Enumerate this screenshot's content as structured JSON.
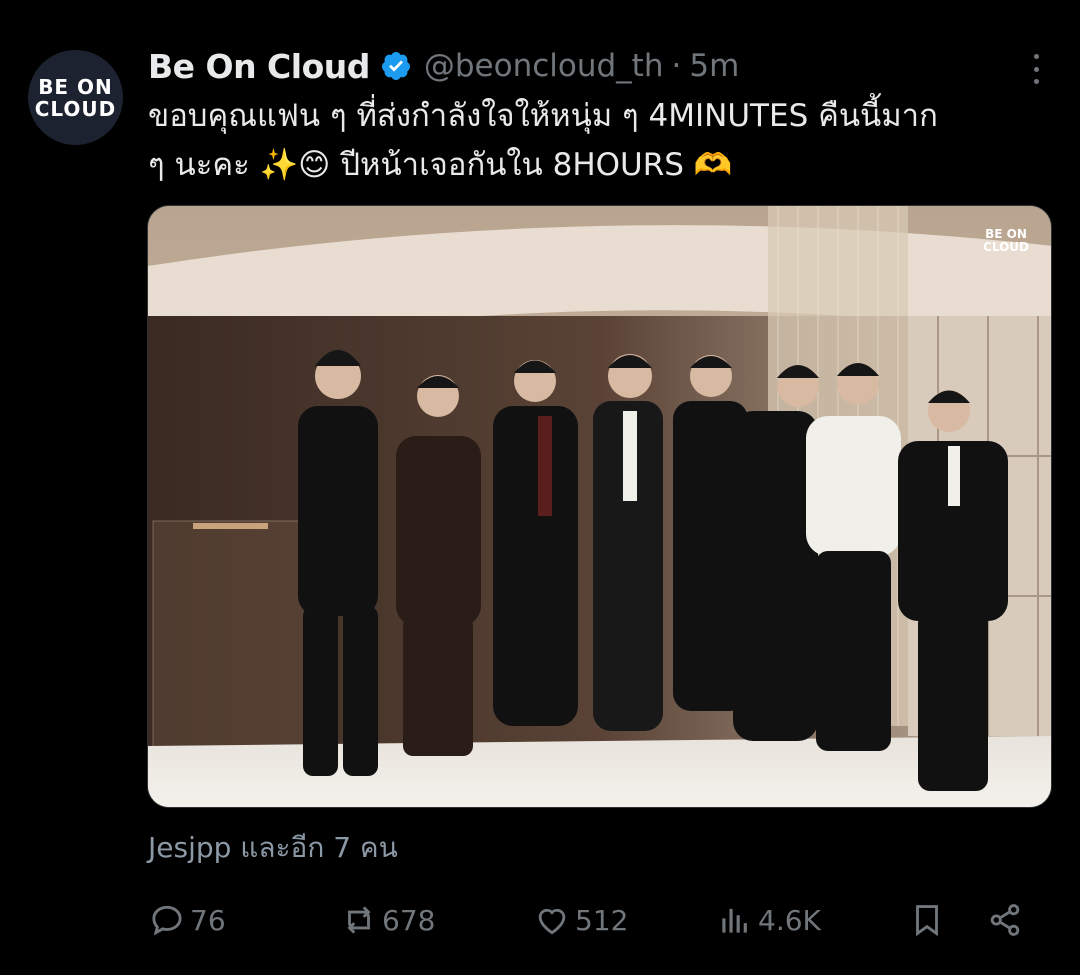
{
  "account": {
    "avatar_text_line1": "BE ON",
    "avatar_text_line2": "CLOUD",
    "display_name": "Be On Cloud",
    "handle": "@beoncloud_th",
    "separator": "·",
    "time": "5m",
    "verified": true
  },
  "tweet": {
    "line1": "ขอบคุณแฟน ๆ ที่ส่งกำลังใจให้หนุ่ม ๆ 4MINUTES คืนนี้มาก",
    "line2": "ๆ นะคะ ✨😊 ปีหน้าเจอกันใน 8HOURS 🫶"
  },
  "media": {
    "watermark_line1": "BE ON",
    "watermark_line2": "CLOUD",
    "alt": "Eight people in black and white formal outfits posing in a lobby"
  },
  "likers": "Jesjpp และอีก 7 คน",
  "actions": {
    "replies": "76",
    "reposts": "678",
    "likes": "512",
    "views": "4.6K"
  },
  "colors": {
    "background": "#000000",
    "text": "#e7e9ea",
    "secondary": "#71767b",
    "verified": "#1d9bf0"
  }
}
